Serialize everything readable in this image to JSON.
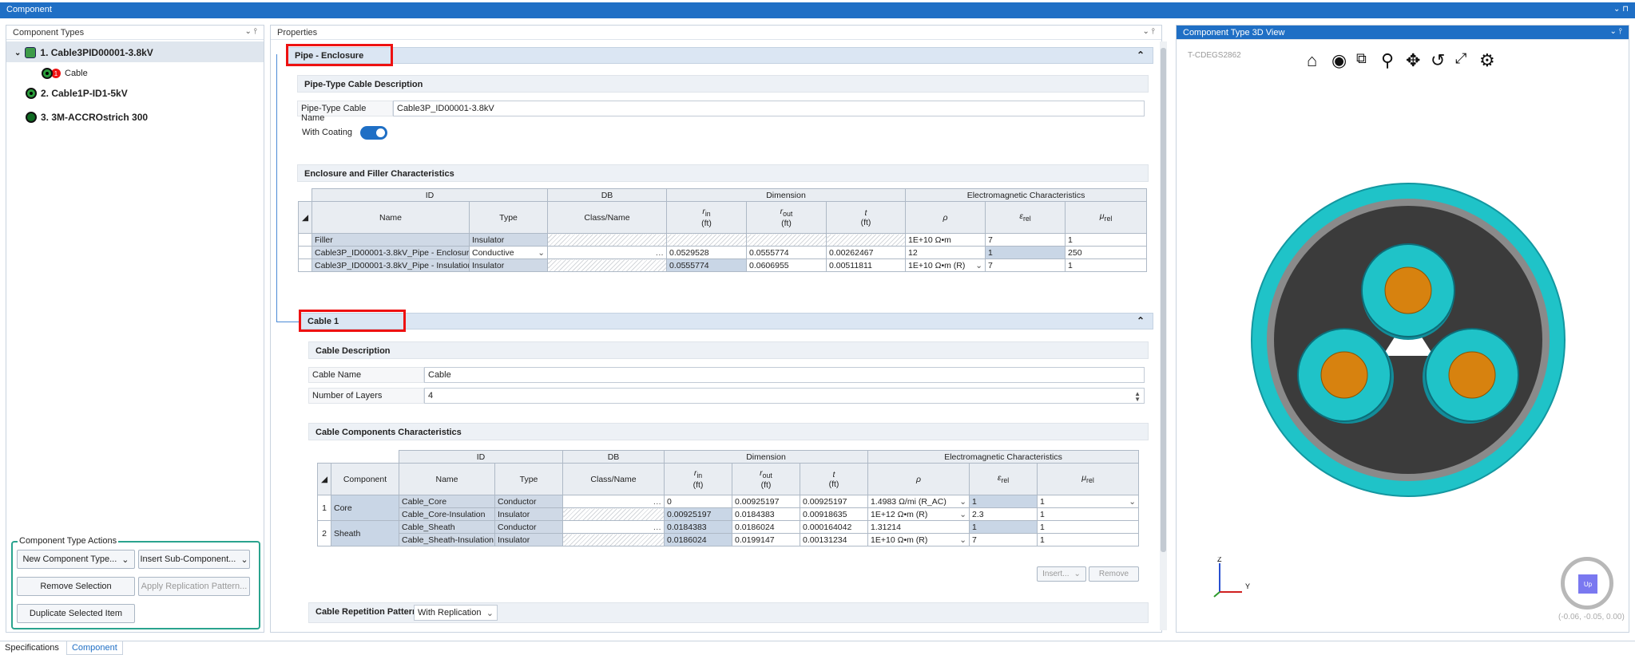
{
  "window": {
    "title": "Component"
  },
  "left": {
    "header": "Component Types",
    "tree": [
      {
        "label": "1. Cable3PID00001-3.8kV",
        "child": "Cable",
        "badge": "1"
      },
      {
        "label": "2. Cable1P-ID1-5kV"
      },
      {
        "label": "3. 3M-ACCROstrich 300"
      }
    ],
    "actions": {
      "title": "Component Type Actions",
      "new_type": "New Component Type...",
      "insert_sub": "Insert Sub-Component...",
      "remove": "Remove Selection",
      "apply_rep": "Apply Replication Pattern...",
      "duplicate": "Duplicate Selected Item"
    }
  },
  "props": {
    "header": "Properties",
    "enclosure": {
      "section": "Pipe - Enclosure",
      "desc_title": "Pipe-Type Cable Description",
      "name_label": "Pipe-Type Cable Name",
      "name_value": "Cable3P_ID00001-3.8kV",
      "coating_label": "With Coating",
      "coating_on": true,
      "char_title": "Enclosure and Filler Characteristics",
      "groups": {
        "id": "ID",
        "db": "DB",
        "dim": "Dimension",
        "em": "Electromagnetic Characteristics"
      },
      "cols": {
        "name": "Name",
        "type": "Type",
        "class": "Class/Name",
        "rin": "r",
        "rin_sub": "in",
        "rout": "r",
        "rout_sub": "out",
        "t": "t",
        "ft": "(ft)",
        "rho": "ρ",
        "erel": "ε",
        "erel_sub": "rel",
        "mu": "μ",
        "mu_sub": "rel"
      },
      "rows": [
        {
          "name": "Filler",
          "type": "Insulator",
          "rin": "",
          "rout": "",
          "t": "",
          "rho": "1E+10 Ω•m",
          "erel": "7",
          "mu": "1"
        },
        {
          "name": "Cable3P_ID00001-3.8kV_Pipe - Enclosure",
          "type": "Conductive",
          "rin": "0.0529528",
          "rout": "0.0555774",
          "t": "0.00262467",
          "rho": "12",
          "erel": "1",
          "mu": "250"
        },
        {
          "name": "Cable3P_ID00001-3.8kV_Pipe - Insulation",
          "type": "Insulator",
          "rin": "0.0555774",
          "rout": "0.0606955",
          "t": "0.00511811",
          "rho": "1E+10 Ω•m (R)",
          "erel": "7",
          "mu": "1"
        }
      ]
    },
    "cable": {
      "section": "Cable 1",
      "desc_title": "Cable Description",
      "name_label": "Cable Name",
      "name_value": "Cable",
      "layers_label": "Number of Layers",
      "layers_value": "4",
      "char_title": "Cable Components Characteristics",
      "component_col": "Component",
      "rows": [
        {
          "idx": "1",
          "comp": "Core",
          "name": "Cable_Core",
          "type": "Conductor",
          "rin": "0",
          "rout": "0.00925197",
          "t": "0.00925197",
          "rho": "1.4983 Ω/mi (R_AC)",
          "erel": "1",
          "mu": "1"
        },
        {
          "idx": "",
          "comp": "",
          "name": "Cable_Core-Insulation",
          "type": "Insulator",
          "rin": "0.00925197",
          "rout": "0.0184383",
          "t": "0.00918635",
          "rho": "1E+12 Ω•m (R)",
          "erel": "2.3",
          "mu": "1"
        },
        {
          "idx": "2",
          "comp": "Sheath",
          "name": "Cable_Sheath",
          "type": "Conductor",
          "rin": "0.0184383",
          "rout": "0.0186024",
          "t": "0.000164042",
          "rho": "1.31214",
          "erel": "1",
          "mu": "1"
        },
        {
          "idx": "",
          "comp": "",
          "name": "Cable_Sheath-Insulation",
          "type": "Insulator",
          "rin": "0.0186024",
          "rout": "0.0199147",
          "t": "0.00131234",
          "rho": "1E+10 Ω•m (R)",
          "erel": "7",
          "mu": "1"
        }
      ],
      "insert_btn": "Insert...",
      "remove_btn": "Remove",
      "rep_label": "Cable Repetition Pattern",
      "rep_value": "With Replication"
    }
  },
  "view3d": {
    "header": "Component Type 3D View",
    "id_label": "T-CDEGS2862",
    "up_label": "Up",
    "coords": "(-0.06, -0.05, 0.00)",
    "axes": {
      "z": "Z",
      "y": "Y"
    },
    "tools": [
      "home-icon",
      "view-icon",
      "zoom-box-icon",
      "zoom-icon",
      "pan-icon",
      "rotate-icon",
      "fit-icon",
      "settings-icon"
    ]
  },
  "bottom_tabs": {
    "spec": "Specifications",
    "comp": "Component"
  },
  "colors": {
    "accent": "#1f6fc5",
    "teal": "#1fc3c8",
    "copper": "#d7820f",
    "red": "#e11111"
  }
}
